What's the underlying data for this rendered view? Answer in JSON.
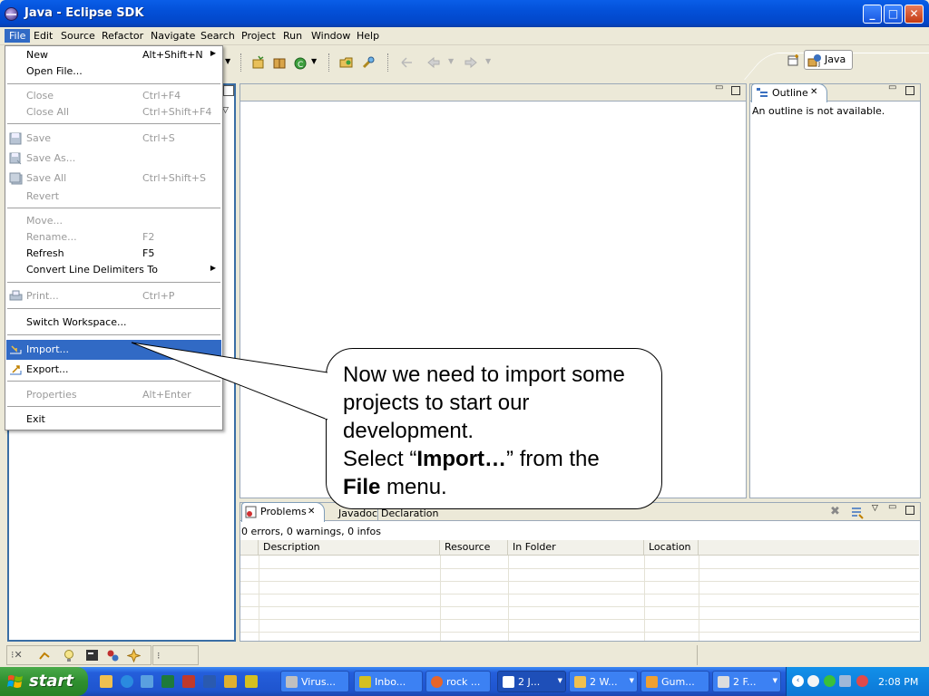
{
  "window": {
    "title": "Java - Eclipse SDK",
    "buttons": {
      "minimize": "_",
      "maximize": "□",
      "close": "✕"
    }
  },
  "menubar": {
    "items": [
      "File",
      "Edit",
      "Source",
      "Refactor",
      "Navigate",
      "Search",
      "Project",
      "Run",
      "Window",
      "Help"
    ],
    "active": "File"
  },
  "perspective": {
    "label": "Java"
  },
  "file_menu": {
    "items": [
      {
        "label": "New",
        "accel": "Alt+Shift+N",
        "submenu": true,
        "enabled": true
      },
      {
        "label": "Open File...",
        "accel": "",
        "enabled": true
      },
      {
        "label": "Close",
        "accel": "Ctrl+F4",
        "enabled": false
      },
      {
        "label": "Close All",
        "accel": "Ctrl+Shift+F4",
        "enabled": false
      },
      {
        "label": "Save",
        "accel": "Ctrl+S",
        "enabled": false
      },
      {
        "label": "Save As...",
        "accel": "",
        "enabled": false
      },
      {
        "label": "Save All",
        "accel": "Ctrl+Shift+S",
        "enabled": false
      },
      {
        "label": "Revert",
        "accel": "",
        "enabled": false
      },
      {
        "label": "Move...",
        "accel": "",
        "enabled": false
      },
      {
        "label": "Rename...",
        "accel": "F2",
        "enabled": false
      },
      {
        "label": "Refresh",
        "accel": "F5",
        "enabled": true
      },
      {
        "label": "Convert Line Delimiters To",
        "accel": "",
        "submenu": true,
        "enabled": true
      },
      {
        "label": "Print...",
        "accel": "Ctrl+P",
        "enabled": false
      },
      {
        "label": "Switch Workspace...",
        "accel": "",
        "enabled": true
      },
      {
        "label": "Import...",
        "accel": "",
        "enabled": true,
        "selected": true
      },
      {
        "label": "Export...",
        "accel": "",
        "enabled": true
      },
      {
        "label": "Properties",
        "accel": "Alt+Enter",
        "enabled": false
      },
      {
        "label": "Exit",
        "accel": "",
        "enabled": true
      }
    ]
  },
  "outline": {
    "tab": "Outline",
    "message": "An outline is not available."
  },
  "problems": {
    "tabs": [
      "Problems",
      "Javadoc",
      "Declaration"
    ],
    "summary": "0 errors, 0 warnings, 0 infos",
    "columns": [
      "Description",
      "Resource",
      "In Folder",
      "Location"
    ]
  },
  "callout": {
    "line1": "Now we need to import some projects to start our development.",
    "line2_pre": "Select “",
    "line2_bold": "Import…",
    "line2_post": "” from the",
    "line3_bold": "File",
    "line3_post": " menu."
  },
  "taskbar": {
    "start": "start",
    "tasks": [
      "Virus...",
      "Inbo...",
      "rock ...",
      "2 J...",
      "2 W...",
      "Gum...",
      "2 F..."
    ],
    "clock": "2:08 PM"
  },
  "colors": {
    "menu_selection": "#316ac5",
    "titlebar": "#0350d8",
    "taskbar": "#245edb",
    "start_button": "#2f8f2f"
  }
}
